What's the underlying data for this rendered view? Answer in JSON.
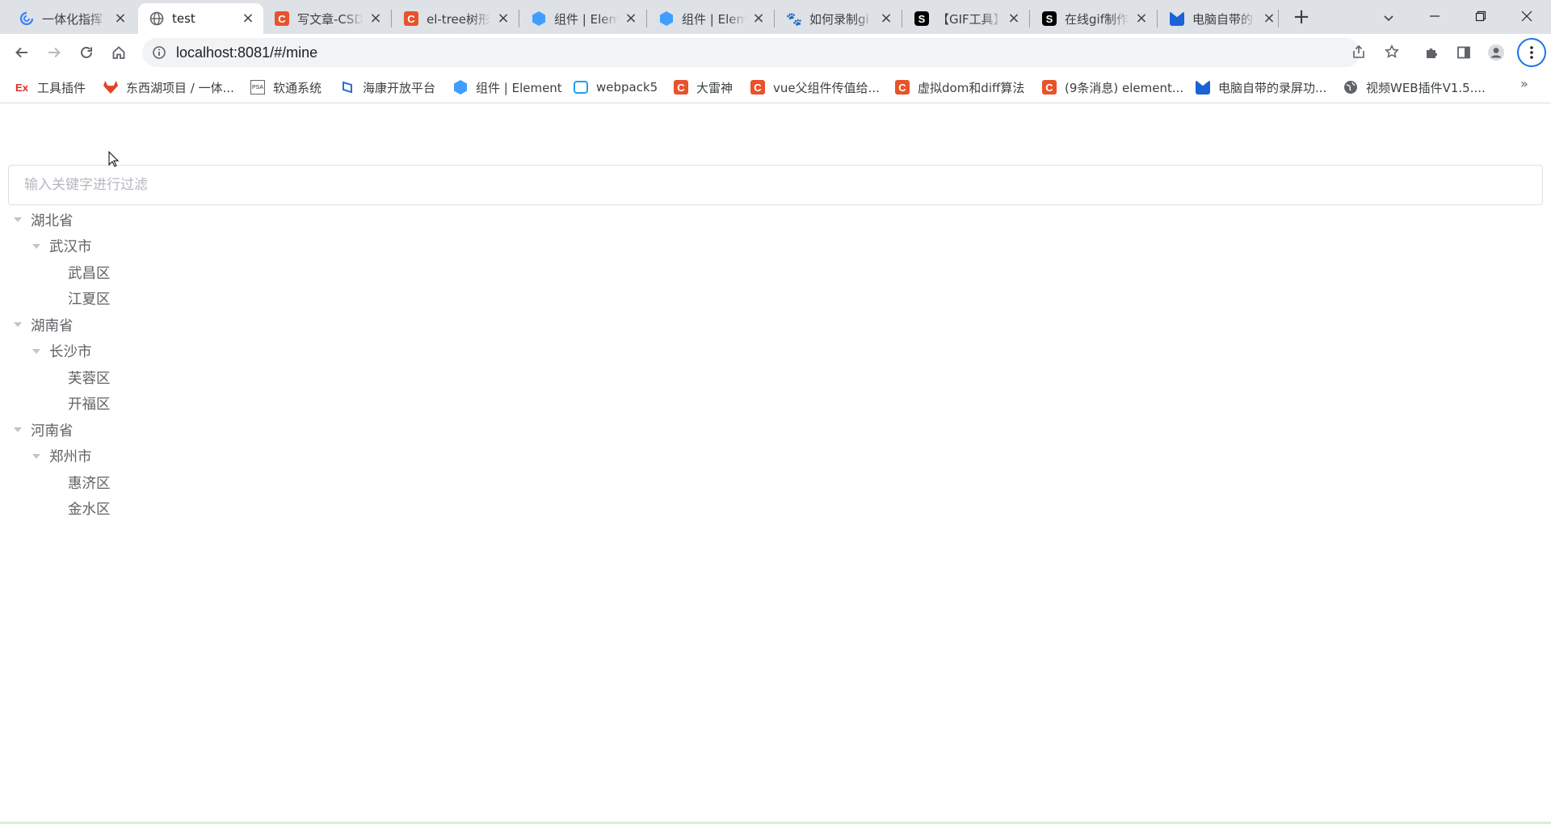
{
  "tabs": [
    {
      "title": "一体化指挥",
      "favicon": "swirl-icon",
      "active": false
    },
    {
      "title": "test",
      "favicon": "globe-icon",
      "active": true
    },
    {
      "title": "写文章-CSDN",
      "favicon": "csdn-icon",
      "active": false
    },
    {
      "title": "el-tree树形",
      "favicon": "csdn-icon",
      "active": false
    },
    {
      "title": "组件 | Elem",
      "favicon": "element-icon",
      "active": false
    },
    {
      "title": "组件 | Elem",
      "favicon": "element-icon",
      "active": false
    },
    {
      "title": "如何录制gi",
      "favicon": "baidu-icon",
      "active": false
    },
    {
      "title": "【GIF工具】",
      "favicon": "s-icon",
      "active": false
    },
    {
      "title": "在线gif制作",
      "favicon": "s-icon",
      "active": false
    },
    {
      "title": "电脑自带的",
      "favicon": "blue-icon",
      "active": false
    }
  ],
  "address": {
    "url": "localhost:8081/#/mine"
  },
  "bookmarks": [
    {
      "label": "工具插件",
      "icon": "ex-icon"
    },
    {
      "label": "东西湖项目 / 一体...",
      "icon": "gitlab-icon"
    },
    {
      "label": "软通系统",
      "icon": "psa-icon"
    },
    {
      "label": "海康开放平台",
      "icon": "hikvision-icon"
    },
    {
      "label": "组件 | Element",
      "icon": "element-icon"
    },
    {
      "label": "webpack5",
      "icon": "bilibili-icon"
    },
    {
      "label": "大雷神",
      "icon": "csdn-icon"
    },
    {
      "label": "vue父组件传值给...",
      "icon": "csdn-icon"
    },
    {
      "label": "虚拟dom和diff算法",
      "icon": "csdn-icon"
    },
    {
      "label": "(9条消息) element...",
      "icon": "csdn-icon"
    },
    {
      "label": "电脑自带的录屏功...",
      "icon": "blue-icon"
    },
    {
      "label": "视频WEB插件V1.5....",
      "icon": "globe-icon"
    }
  ],
  "bookmarks_more": "»",
  "filter": {
    "placeholder": "输入关键字进行过滤",
    "value": ""
  },
  "tree": [
    {
      "label": "湖北省",
      "children": [
        {
          "label": "武汉市",
          "children": [
            {
              "label": "武昌区"
            },
            {
              "label": "江夏区"
            }
          ]
        }
      ]
    },
    {
      "label": "湖南省",
      "children": [
        {
          "label": "长沙市",
          "children": [
            {
              "label": "芙蓉区"
            },
            {
              "label": "开福区"
            }
          ]
        }
      ]
    },
    {
      "label": "河南省",
      "children": [
        {
          "label": "郑州市",
          "children": [
            {
              "label": "惠济区"
            },
            {
              "label": "金水区"
            }
          ]
        }
      ]
    }
  ],
  "colors": {
    "tree_text": "#606266",
    "caret": "#c0c4cc",
    "accent": "#1a73e8"
  }
}
